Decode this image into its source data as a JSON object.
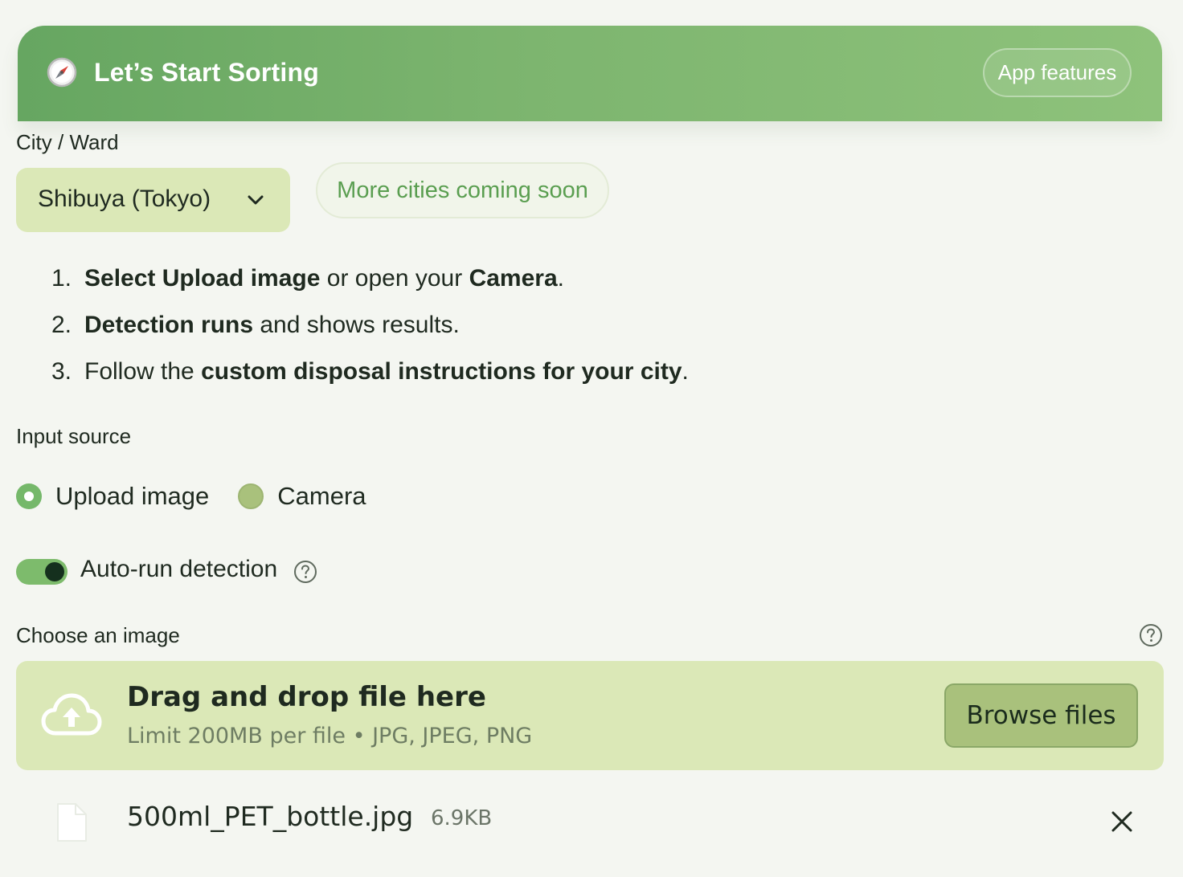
{
  "header": {
    "title": "Let’s Start Sorting",
    "icon": "compass-icon",
    "features_button": "App features"
  },
  "city": {
    "label": "City / Ward",
    "selected": "Shibuya (Tokyo)",
    "coming_soon": "More cities coming soon"
  },
  "steps": [
    {
      "number": "1.",
      "b1": "Select Upload image",
      "t1": " or open your ",
      "b2": "Camera",
      "t2": "."
    },
    {
      "number": "2.",
      "b1": "Detection runs",
      "t1": " and shows results."
    },
    {
      "number": "3.",
      "t0": "Follow the ",
      "b1": "custom disposal instructions for your city",
      "t1": "."
    }
  ],
  "input_source": {
    "label": "Input source",
    "options": [
      {
        "label": "Upload image",
        "selected": true
      },
      {
        "label": "Camera",
        "selected": false
      }
    ]
  },
  "auto_run": {
    "label": "Auto-run detection",
    "enabled": true
  },
  "uploader": {
    "label": "Choose an image",
    "drop_title": "Drag and drop file here",
    "drop_subtitle": "Limit 200MB per file • JPG, JPEG, PNG",
    "browse_button": "Browse files"
  },
  "file": {
    "name": "500ml_PET_bottle.jpg",
    "size": "6.9KB"
  },
  "colors": {
    "accent_green": "#75b86a",
    "panel_green": "#dbe8b7",
    "header_start": "#66a661",
    "header_end": "#8ec27b",
    "background": "#f4f6f1"
  }
}
